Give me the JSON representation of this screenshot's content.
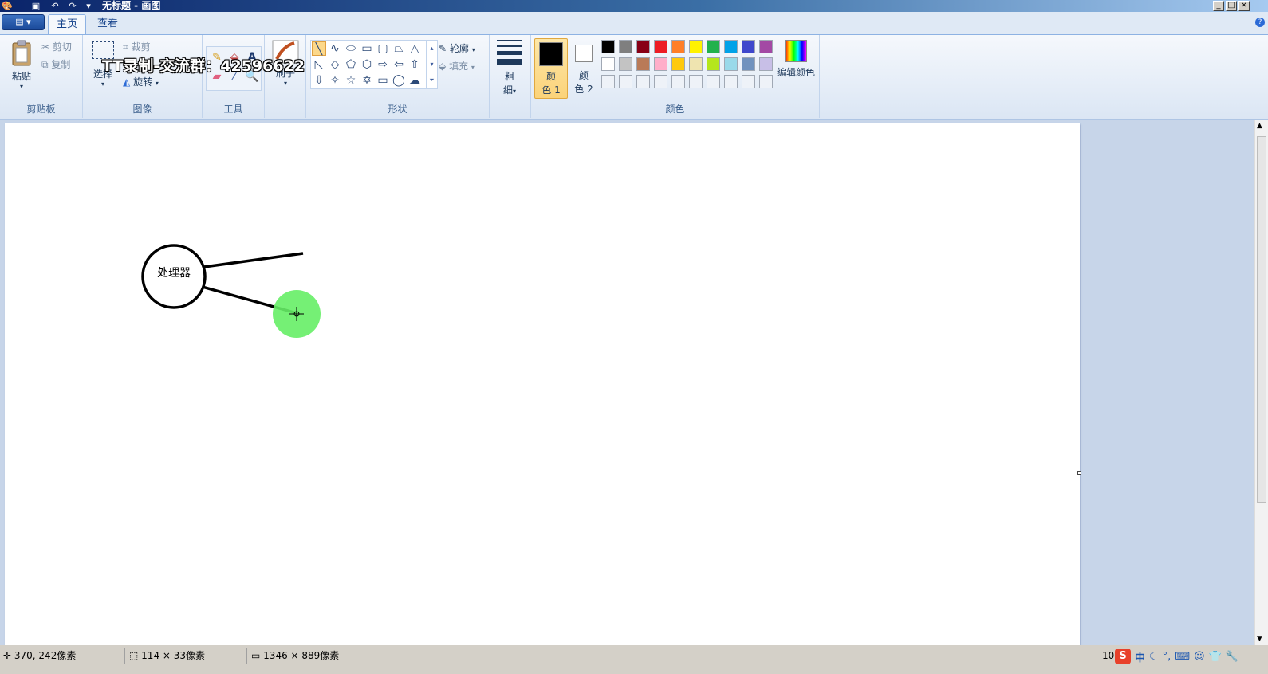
{
  "window": {
    "title": "无标题 - 画图",
    "minimize": "_",
    "maximize": "□",
    "close": "×"
  },
  "ribbon": {
    "app_menu_label": "▤ ▾",
    "tabs": [
      {
        "label": "主页",
        "active": true
      },
      {
        "label": "查看",
        "active": false
      }
    ],
    "help": "?",
    "groups": {
      "clipboard": {
        "label": "剪贴板",
        "paste": "粘贴",
        "cut": "剪切",
        "copy": "复制"
      },
      "image": {
        "label": "图像",
        "select": "选择",
        "crop": "裁剪",
        "rotate": "旋转"
      },
      "tools": {
        "label": "工具"
      },
      "brushes": {
        "label": "刷子"
      },
      "shapes": {
        "label": "形状",
        "outline": "轮廓",
        "fill": "填充"
      },
      "size": {
        "label_line1": "粗",
        "label_line2": "细"
      },
      "colors": {
        "label": "颜色",
        "color1_line1": "颜",
        "color1_line2": "色 1",
        "color2_line1": "颜",
        "color2_line2": "色 2",
        "edit_colors": "编辑颜色",
        "color1_value": "#000000",
        "color2_value": "#ffffff",
        "palette_row1": [
          "#000000",
          "#7f7f7f",
          "#880015",
          "#ed1c24",
          "#ff7f27",
          "#fff200",
          "#22b14c",
          "#00a2e8",
          "#3f48cc",
          "#a349a4"
        ],
        "palette_row2": [
          "#ffffff",
          "#c3c3c3",
          "#b97a57",
          "#ffaec9",
          "#ffc90e",
          "#efe4b0",
          "#b5e61d",
          "#99d9ea",
          "#7092be",
          "#c8bfe7"
        ]
      }
    }
  },
  "watermark": "TT录制-交流群：42596622",
  "canvas": {
    "node_label": "处理器",
    "cursor_highlight_color": "#66ee66"
  },
  "statusbar": {
    "cursor_pos": "370, 242像素",
    "selection_size": "114 × 33像素",
    "image_size": "1346 × 889像素",
    "zoom_partial": "10"
  },
  "tray": {
    "ime_logo": "S",
    "ime_mode": "中"
  }
}
